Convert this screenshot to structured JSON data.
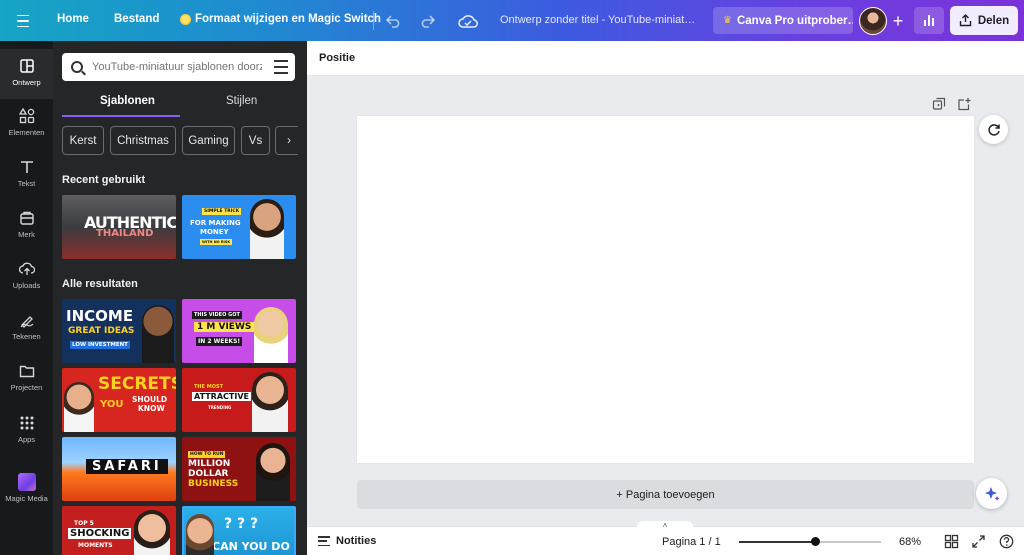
{
  "topbar": {
    "home": "Home",
    "file": "Bestand",
    "resize": "Formaat wijzigen en Magic Switch",
    "doc_title": "Ontwerp zonder titel - YouTube-miniat…",
    "pro": "Canva Pro uitprober…",
    "share": "Delen"
  },
  "rail": {
    "items": [
      {
        "label": "Ontwerp",
        "icon": "layout-icon"
      },
      {
        "label": "Elementen",
        "icon": "shapes-icon"
      },
      {
        "label": "Tekst",
        "icon": "text-icon"
      },
      {
        "label": "Merk",
        "icon": "brand-icon"
      },
      {
        "label": "Uploads",
        "icon": "upload-icon"
      },
      {
        "label": "Tekenen",
        "icon": "draw-icon"
      },
      {
        "label": "Projecten",
        "icon": "folder-icon"
      },
      {
        "label": "Apps",
        "icon": "apps-icon"
      },
      {
        "label": "Magic Media",
        "icon": "magic-media-icon"
      }
    ]
  },
  "panel": {
    "search_placeholder": "YouTube-miniatuur sjablonen doorzoeken",
    "tabs": [
      "Sjablonen",
      "Stijlen"
    ],
    "chips": [
      "Kerst",
      "Christmas",
      "Gaming",
      "Vs",
      "N"
    ],
    "recent_title": "Recent gebruikt",
    "all_title": "Alle resultaten",
    "thumbs": {
      "authentic": [
        "AUTHENTIC",
        "THAILAND"
      ],
      "money": [
        "SIMPLE TRICK",
        "FOR MAKING",
        "MONEY",
        "WITH NO RISK"
      ],
      "income": [
        "INCOME",
        "GREAT IDEAS",
        "LOW INVESTMENT"
      ],
      "views": [
        "THIS VIDEO GOT",
        "1 M VIEWS",
        "IN 2 WEEKS!"
      ],
      "secrets": [
        "SECRETS",
        "YOU",
        "SHOULD",
        "KNOW"
      ],
      "attractive": [
        "THE MOST",
        "ATTRACTIVE",
        "TRENDING"
      ],
      "safari": [
        "SAFARI"
      ],
      "million": [
        "HOW TO RUN",
        "MILLION",
        "DOLLAR",
        "BUSINESS"
      ],
      "shocking": [
        "TOP 5",
        "SHOCKING",
        "MOMENTS"
      ],
      "canyoudo": [
        "? ? ?",
        "CAN YOU DO"
      ]
    }
  },
  "editor": {
    "position": "Positie",
    "add_page": "+ Pagina toevoegen"
  },
  "bottombar": {
    "notes": "Notities",
    "pages": "Pagina 1 / 1",
    "zoom": "68%",
    "zoom_fraction": 0.54
  },
  "colors": {
    "accent": "#8b5cf6",
    "panel_bg": "#252627",
    "rail_bg": "#18191b"
  }
}
